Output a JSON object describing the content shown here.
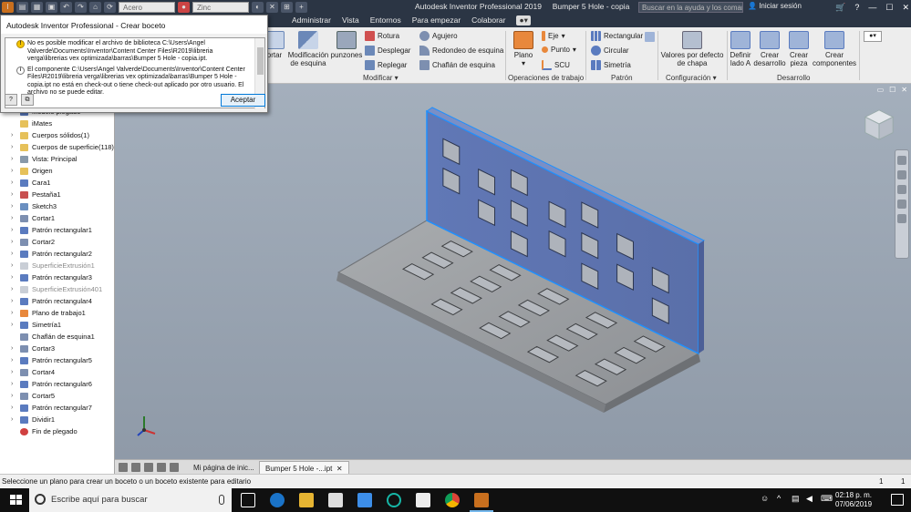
{
  "titlebar": {
    "material": "Acero",
    "appearance": "Zinc",
    "app_title": "Autodesk Inventor Professional 2019",
    "document_title": "Bumper 5 Hole - copia",
    "search_placeholder": "Buscar en la ayuda y los comandos",
    "signin": "Iniciar sesión"
  },
  "menu": {
    "tabs": [
      "Administrar",
      "Vista",
      "Entornos",
      "Para empezar",
      "Colaborar"
    ]
  },
  "ribbon": {
    "cortar_partial": "ortar",
    "modify_big": [
      {
        "label": "Modificación de esquina"
      },
      {
        "label": "punzones"
      }
    ],
    "modify_small_col1": [
      "Rotura",
      "Desplegar",
      "Replegar"
    ],
    "modify_small_col2": [
      "Agujero",
      "Redondeo de esquina",
      "Chaflán de esquina"
    ],
    "modify_group": "Modificar",
    "work": {
      "plano": "Plano",
      "eje": "Eje",
      "punto": "Punto",
      "scu": "SCU"
    },
    "work_group": "Operaciones de trabajo",
    "pattern": [
      "Rectangular",
      "Circular",
      "Simetría"
    ],
    "pattern_group": "Patrón",
    "config": {
      "label": "Valores por defecto de chapa"
    },
    "config_group": "Configuración",
    "flat": [
      {
        "label": "Definir lado A"
      },
      {
        "label": "Crear desarrollo"
      },
      {
        "label": "Crear pieza"
      },
      {
        "label": "Crear componentes"
      }
    ],
    "flat_group": "Desarrollo"
  },
  "dialog": {
    "title": "Autodesk Inventor Professional - Crear boceto",
    "messages": [
      {
        "type": "warning",
        "text": "No es posible modificar el archivo de biblioteca C:\\Users\\Angel Valverde\\Documents\\Inventor\\Content Center Files\\R2019\\libreria verga\\librerias vex optimizada\\barras\\Bumper 5 Hole - copia.ipt."
      },
      {
        "type": "info",
        "text": "El componente C:\\Users\\Angel Valverde\\Documents\\Inventor\\Content Center Files\\R2019\\libreria verga\\librerias vex optimizada\\barras\\Bumper 5 Hole - copia.ipt no está en check-out o tiene check-out aplicado por otro usuario. El archivo no se puede editar."
      }
    ],
    "help_symbol": "?",
    "ok_label": "Aceptar"
  },
  "browser": {
    "nodes": [
      {
        "label": "Modelo plegado",
        "icon": "model-icon",
        "expander": "",
        "dim": false
      },
      {
        "label": "iMates",
        "icon": "folder-icon",
        "expander": "",
        "dim": false
      },
      {
        "label": "Cuerpos sólidos(1)",
        "icon": "folder-icon",
        "expander": "›",
        "dim": false
      },
      {
        "label": "Cuerpos de superficie(118)",
        "icon": "folder-icon",
        "expander": "›",
        "dim": false
      },
      {
        "label": "Vista: Principal",
        "icon": "view-icon",
        "expander": "›",
        "dim": false
      },
      {
        "label": "Origen",
        "icon": "folder-icon",
        "expander": "›",
        "dim": false
      },
      {
        "label": "Cara1",
        "icon": "face-icon",
        "expander": "›",
        "dim": false
      },
      {
        "label": "Pestaña1",
        "icon": "flange-icon",
        "expander": "›",
        "dim": false
      },
      {
        "label": "Sketch3",
        "icon": "sketch-icon",
        "expander": "›",
        "dim": false
      },
      {
        "label": "Cortar1",
        "icon": "cut-icon",
        "expander": "›",
        "dim": false
      },
      {
        "label": "Patrón rectangular1",
        "icon": "pattern-icon",
        "expander": "›",
        "dim": false
      },
      {
        "label": "Cortar2",
        "icon": "cut-icon",
        "expander": "›",
        "dim": false
      },
      {
        "label": "Patrón rectangular2",
        "icon": "pattern-icon",
        "expander": "›",
        "dim": false
      },
      {
        "label": "SuperficieExtrusión1",
        "icon": "surface-icon",
        "expander": "›",
        "dim": true
      },
      {
        "label": "Patrón rectangular3",
        "icon": "pattern-icon",
        "expander": "›",
        "dim": false
      },
      {
        "label": "SuperficieExtrusión401",
        "icon": "surface-icon",
        "expander": "›",
        "dim": true
      },
      {
        "label": "Patrón rectangular4",
        "icon": "pattern-icon",
        "expander": "›",
        "dim": false
      },
      {
        "label": "Plano de trabajo1",
        "icon": "plane-icon",
        "expander": "›",
        "dim": false
      },
      {
        "label": "Simetría1",
        "icon": "mirror-icon",
        "expander": "›",
        "dim": false
      },
      {
        "label": "Chaflán de esquina1",
        "icon": "chamfer-icon",
        "expander": "",
        "dim": false
      },
      {
        "label": "Cortar3",
        "icon": "cut-icon",
        "expander": "›",
        "dim": false
      },
      {
        "label": "Patrón rectangular5",
        "icon": "pattern-icon",
        "expander": "›",
        "dim": false
      },
      {
        "label": "Cortar4",
        "icon": "cut-icon",
        "expander": "›",
        "dim": false
      },
      {
        "label": "Patrón rectangular6",
        "icon": "pattern-icon",
        "expander": "›",
        "dim": false
      },
      {
        "label": "Cortar5",
        "icon": "cut-icon",
        "expander": "›",
        "dim": false
      },
      {
        "label": "Patrón rectangular7",
        "icon": "pattern-icon",
        "expander": "›",
        "dim": false
      },
      {
        "label": "Dividir1",
        "icon": "split-icon",
        "expander": "›",
        "dim": false
      },
      {
        "label": "Fin de plegado",
        "icon": "end-of-fold-icon",
        "expander": "",
        "dim": false
      }
    ]
  },
  "doctabs": {
    "home": "Mi página de inic...",
    "active": "Bumper 5 Hole -...ipt",
    "close": "✕"
  },
  "statusbar": {
    "text": "Seleccione un plano para crear un boceto o un boceto existente para editario",
    "page_a": "1",
    "page_b": "1"
  },
  "taskbar": {
    "search_placeholder": "Escribe aquí para buscar",
    "time": "02:18 p. m.",
    "date": "07/06/2019"
  },
  "colors": {
    "titlebar": "#2b3544",
    "ribbon": "#ededed",
    "viewport_top": "#a4afbc",
    "selected_face": "#5f76b7",
    "part_gray": "#999c9f"
  }
}
